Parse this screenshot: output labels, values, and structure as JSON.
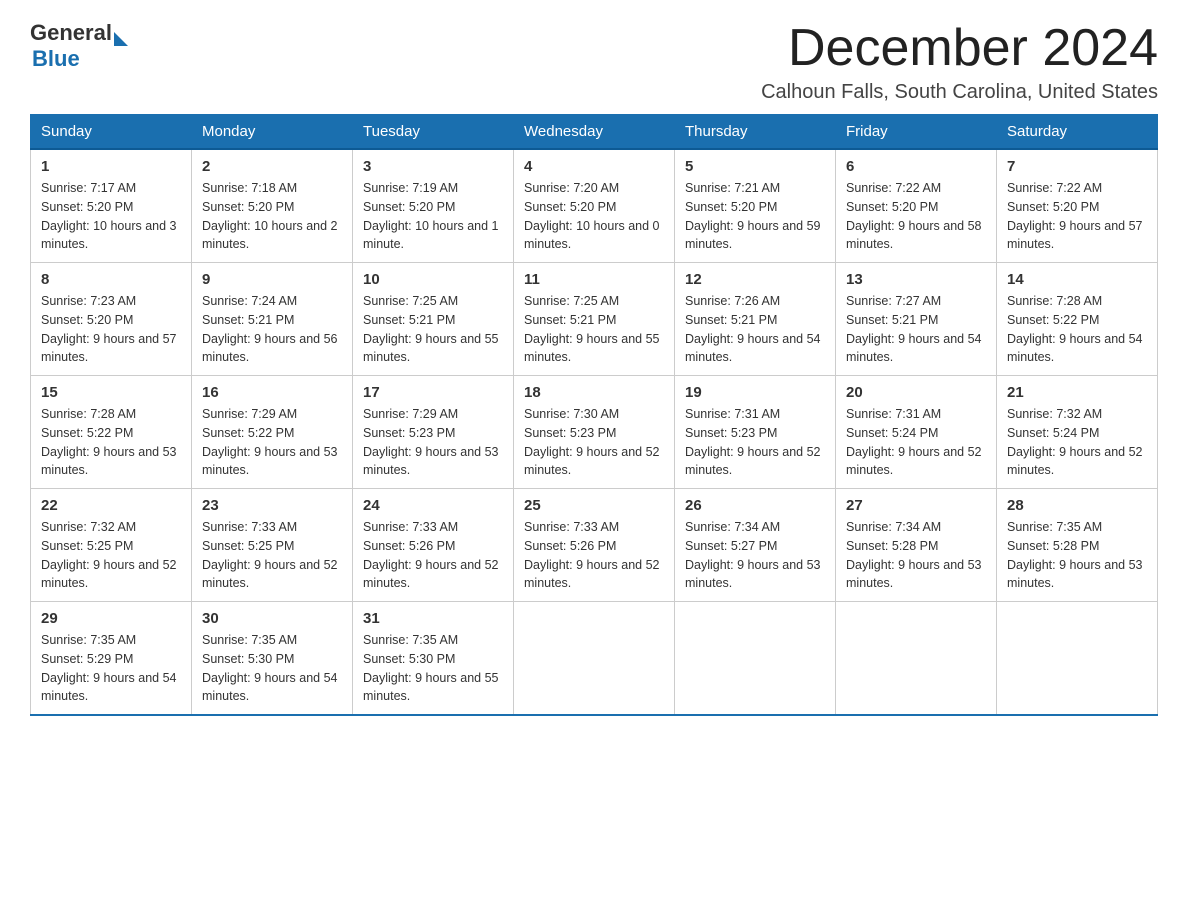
{
  "logo": {
    "text_general": "General",
    "text_blue": "Blue"
  },
  "title": "December 2024",
  "subtitle": "Calhoun Falls, South Carolina, United States",
  "days_of_week": [
    "Sunday",
    "Monday",
    "Tuesday",
    "Wednesday",
    "Thursday",
    "Friday",
    "Saturday"
  ],
  "weeks": [
    [
      {
        "day": "1",
        "sunrise": "7:17 AM",
        "sunset": "5:20 PM",
        "daylight": "10 hours and 3 minutes."
      },
      {
        "day": "2",
        "sunrise": "7:18 AM",
        "sunset": "5:20 PM",
        "daylight": "10 hours and 2 minutes."
      },
      {
        "day": "3",
        "sunrise": "7:19 AM",
        "sunset": "5:20 PM",
        "daylight": "10 hours and 1 minute."
      },
      {
        "day": "4",
        "sunrise": "7:20 AM",
        "sunset": "5:20 PM",
        "daylight": "10 hours and 0 minutes."
      },
      {
        "day": "5",
        "sunrise": "7:21 AM",
        "sunset": "5:20 PM",
        "daylight": "9 hours and 59 minutes."
      },
      {
        "day": "6",
        "sunrise": "7:22 AM",
        "sunset": "5:20 PM",
        "daylight": "9 hours and 58 minutes."
      },
      {
        "day": "7",
        "sunrise": "7:22 AM",
        "sunset": "5:20 PM",
        "daylight": "9 hours and 57 minutes."
      }
    ],
    [
      {
        "day": "8",
        "sunrise": "7:23 AM",
        "sunset": "5:20 PM",
        "daylight": "9 hours and 57 minutes."
      },
      {
        "day": "9",
        "sunrise": "7:24 AM",
        "sunset": "5:21 PM",
        "daylight": "9 hours and 56 minutes."
      },
      {
        "day": "10",
        "sunrise": "7:25 AM",
        "sunset": "5:21 PM",
        "daylight": "9 hours and 55 minutes."
      },
      {
        "day": "11",
        "sunrise": "7:25 AM",
        "sunset": "5:21 PM",
        "daylight": "9 hours and 55 minutes."
      },
      {
        "day": "12",
        "sunrise": "7:26 AM",
        "sunset": "5:21 PM",
        "daylight": "9 hours and 54 minutes."
      },
      {
        "day": "13",
        "sunrise": "7:27 AM",
        "sunset": "5:21 PM",
        "daylight": "9 hours and 54 minutes."
      },
      {
        "day": "14",
        "sunrise": "7:28 AM",
        "sunset": "5:22 PM",
        "daylight": "9 hours and 54 minutes."
      }
    ],
    [
      {
        "day": "15",
        "sunrise": "7:28 AM",
        "sunset": "5:22 PM",
        "daylight": "9 hours and 53 minutes."
      },
      {
        "day": "16",
        "sunrise": "7:29 AM",
        "sunset": "5:22 PM",
        "daylight": "9 hours and 53 minutes."
      },
      {
        "day": "17",
        "sunrise": "7:29 AM",
        "sunset": "5:23 PM",
        "daylight": "9 hours and 53 minutes."
      },
      {
        "day": "18",
        "sunrise": "7:30 AM",
        "sunset": "5:23 PM",
        "daylight": "9 hours and 52 minutes."
      },
      {
        "day": "19",
        "sunrise": "7:31 AM",
        "sunset": "5:23 PM",
        "daylight": "9 hours and 52 minutes."
      },
      {
        "day": "20",
        "sunrise": "7:31 AM",
        "sunset": "5:24 PM",
        "daylight": "9 hours and 52 minutes."
      },
      {
        "day": "21",
        "sunrise": "7:32 AM",
        "sunset": "5:24 PM",
        "daylight": "9 hours and 52 minutes."
      }
    ],
    [
      {
        "day": "22",
        "sunrise": "7:32 AM",
        "sunset": "5:25 PM",
        "daylight": "9 hours and 52 minutes."
      },
      {
        "day": "23",
        "sunrise": "7:33 AM",
        "sunset": "5:25 PM",
        "daylight": "9 hours and 52 minutes."
      },
      {
        "day": "24",
        "sunrise": "7:33 AM",
        "sunset": "5:26 PM",
        "daylight": "9 hours and 52 minutes."
      },
      {
        "day": "25",
        "sunrise": "7:33 AM",
        "sunset": "5:26 PM",
        "daylight": "9 hours and 52 minutes."
      },
      {
        "day": "26",
        "sunrise": "7:34 AM",
        "sunset": "5:27 PM",
        "daylight": "9 hours and 53 minutes."
      },
      {
        "day": "27",
        "sunrise": "7:34 AM",
        "sunset": "5:28 PM",
        "daylight": "9 hours and 53 minutes."
      },
      {
        "day": "28",
        "sunrise": "7:35 AM",
        "sunset": "5:28 PM",
        "daylight": "9 hours and 53 minutes."
      }
    ],
    [
      {
        "day": "29",
        "sunrise": "7:35 AM",
        "sunset": "5:29 PM",
        "daylight": "9 hours and 54 minutes."
      },
      {
        "day": "30",
        "sunrise": "7:35 AM",
        "sunset": "5:30 PM",
        "daylight": "9 hours and 54 minutes."
      },
      {
        "day": "31",
        "sunrise": "7:35 AM",
        "sunset": "5:30 PM",
        "daylight": "9 hours and 55 minutes."
      },
      null,
      null,
      null,
      null
    ]
  ]
}
